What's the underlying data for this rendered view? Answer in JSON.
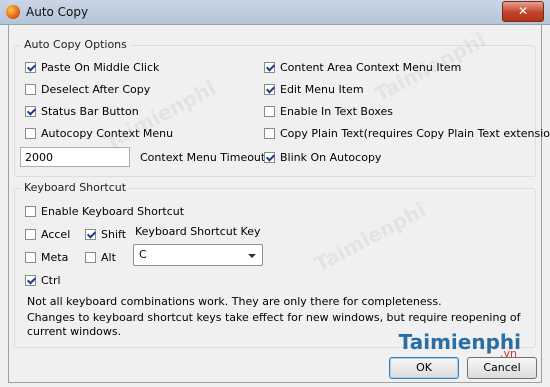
{
  "window": {
    "title": "Auto Copy",
    "close_glyph": "✕"
  },
  "options": {
    "group_title": "Auto Copy Options",
    "left": [
      {
        "label": "Paste On Middle Click",
        "checked": true
      },
      {
        "label": "Deselect After Copy",
        "checked": false
      },
      {
        "label": "Status Bar Button",
        "checked": true
      },
      {
        "label": "Autocopy Context Menu",
        "checked": false
      }
    ],
    "right": [
      {
        "label": "Content Area Context Menu Item",
        "checked": true
      },
      {
        "label": "Edit Menu Item",
        "checked": true
      },
      {
        "label": "Enable In Text Boxes",
        "checked": false
      },
      {
        "label": "Copy Plain Text(requires Copy Plain Text extension)",
        "checked": false
      },
      {
        "label": "Blink On Autocopy",
        "checked": true
      }
    ],
    "timeout_value": "2000",
    "timeout_label": "Context Menu Timeout"
  },
  "shortcut": {
    "group_title": "Keyboard Shortcut",
    "enable": {
      "label": "Enable Keyboard Shortcut",
      "checked": false
    },
    "accel": {
      "label": "Accel",
      "checked": false
    },
    "shift": {
      "label": "Shift",
      "checked": true
    },
    "meta": {
      "label": "Meta",
      "checked": false
    },
    "alt": {
      "label": "Alt",
      "checked": false
    },
    "ctrl": {
      "label": "Ctrl",
      "checked": true
    },
    "key_label": "Keyboard Shortcut Key",
    "key_value": "C",
    "note1": "Not all keyboard combinations work. They are only there for completeness.",
    "note2": "Changes to keyboard shortcut keys take effect for new windows, but require reopening of current windows."
  },
  "buttons": {
    "ok": "OK",
    "cancel": "Cancel"
  },
  "watermark": {
    "logo": "Taimienphi",
    "logo_suffix": ".vn"
  }
}
